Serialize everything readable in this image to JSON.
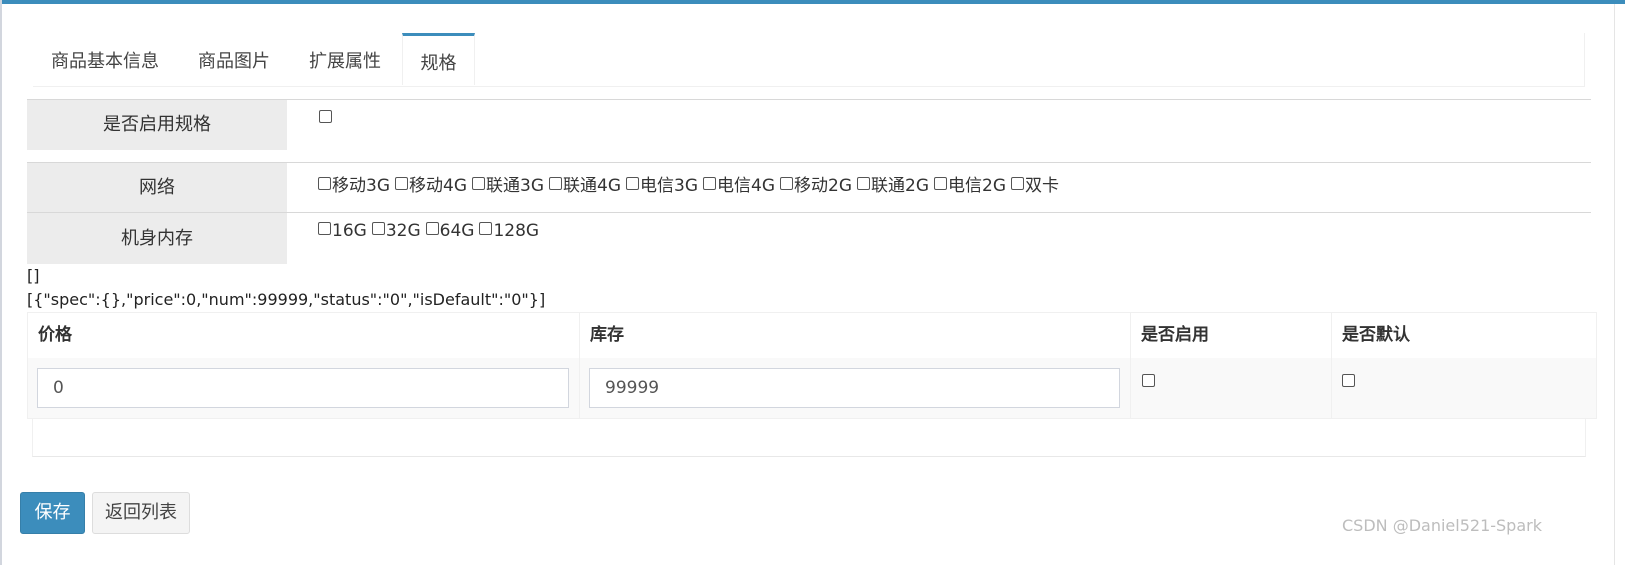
{
  "tabs": [
    {
      "label": "商品基本信息",
      "active": false
    },
    {
      "label": "商品图片",
      "active": false
    },
    {
      "label": "扩展属性",
      "active": false
    },
    {
      "label": "规格",
      "active": true
    }
  ],
  "enable_spec": {
    "label": "是否启用规格",
    "checked": false
  },
  "specs": [
    {
      "label": "网络",
      "options": [
        "移动3G",
        "移动4G",
        "联通3G",
        "联通4G",
        "电信3G",
        "电信4G",
        "移动2G",
        "联通2G",
        "电信2G",
        "双卡"
      ]
    },
    {
      "label": "机身内存",
      "options": [
        "16G",
        "32G",
        "64G",
        "128G"
      ]
    }
  ],
  "debug": {
    "line1": "[]",
    "line2": "[{\"spec\":{},\"price\":0,\"num\":99999,\"status\":\"0\",\"isDefault\":\"0\"}]"
  },
  "sku_table": {
    "headers": [
      "价格",
      "库存",
      "是否启用",
      "是否默认"
    ],
    "row": {
      "price": "0",
      "stock": "99999",
      "enabled": false,
      "is_default": false
    }
  },
  "buttons": {
    "save": "保存",
    "back": "返回列表"
  },
  "watermark": "CSDN @Daniel521-Spark",
  "colors": {
    "accent": "#3c8dbc",
    "label_bg": "#ececec"
  }
}
